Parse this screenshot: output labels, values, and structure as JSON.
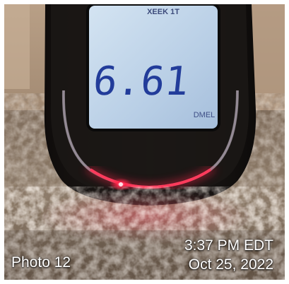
{
  "photo": {
    "label": "Photo 12",
    "time": "3:37 PM EDT",
    "date": "Oct 25, 2022",
    "display": {
      "reading": "6.61",
      "top_text": "XEEK 1T",
      "brand_text": "DMEL"
    },
    "colors": {
      "carpet": "#8a7866",
      "wall": "#c4ae97",
      "device_body": "#151210",
      "lcd": "#c3d6ea",
      "lcd_digits": "#223c9a",
      "led_glow": "#ff2448"
    },
    "subjects": [
      "radon-meter",
      "lcd-display",
      "red-led-arc",
      "carpet"
    ]
  }
}
